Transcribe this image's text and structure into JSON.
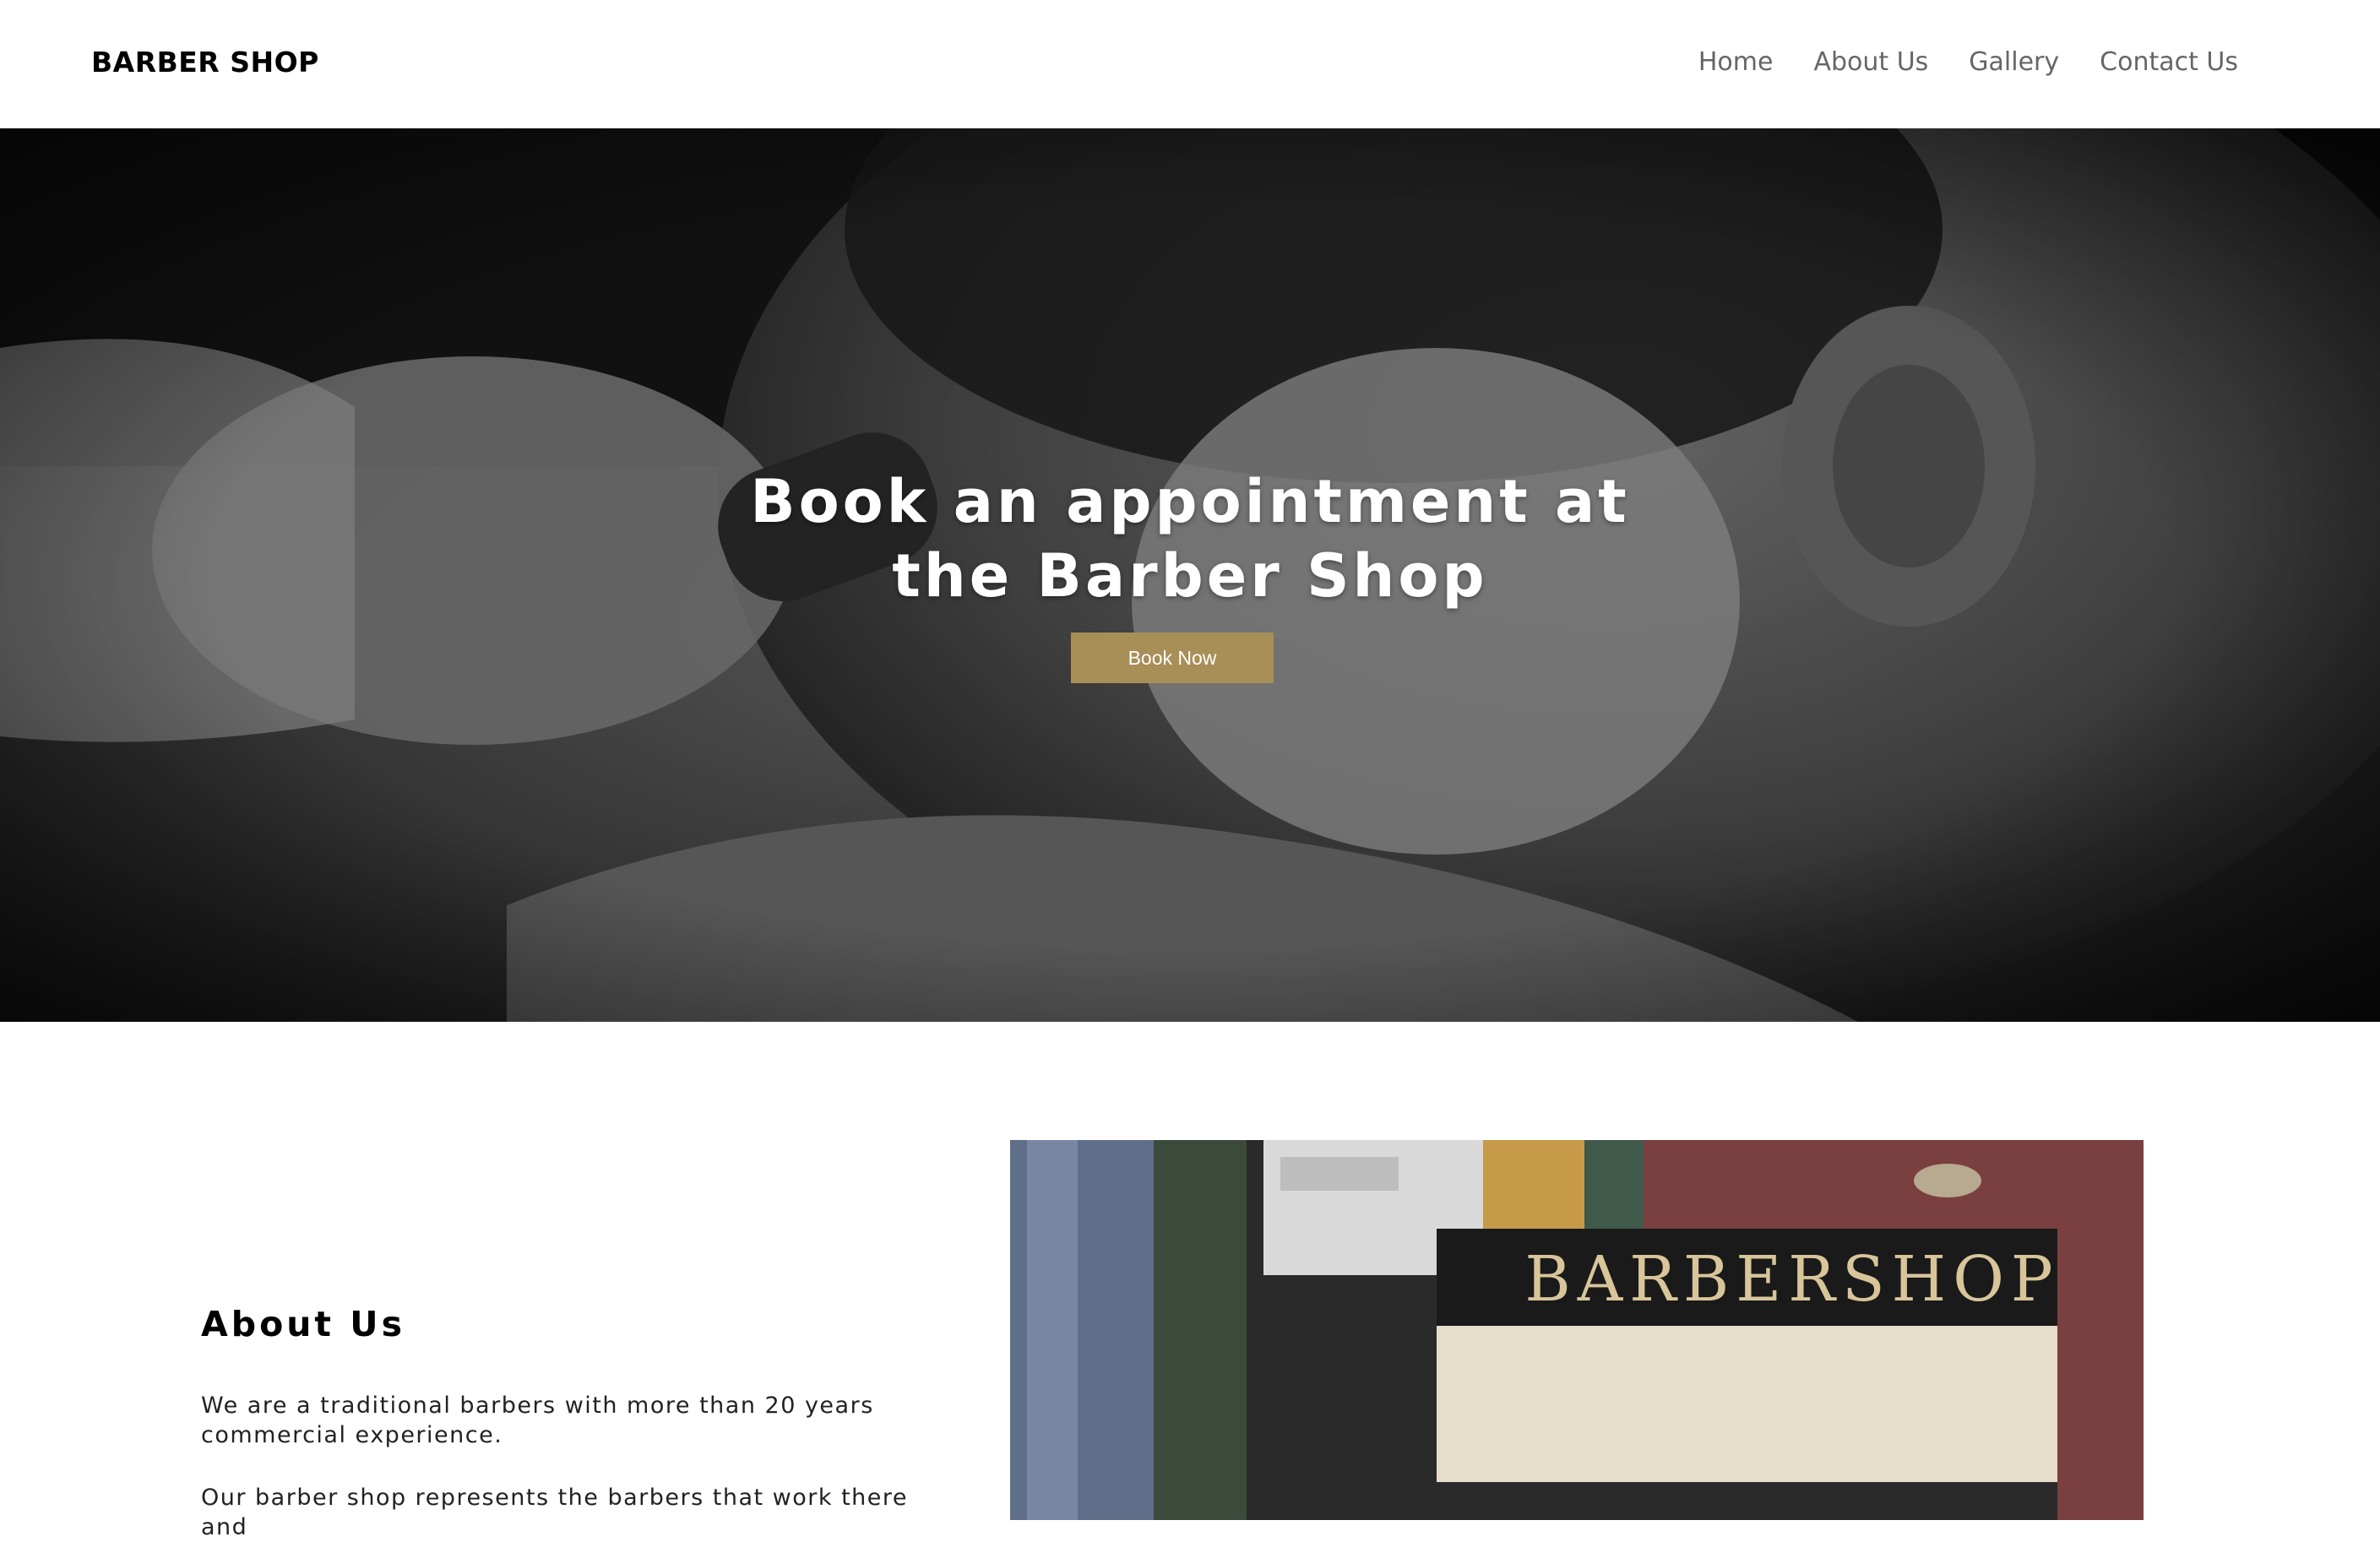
{
  "header": {
    "brand": "BARBER SHOP",
    "nav": [
      {
        "label": "Home"
      },
      {
        "label": "About Us"
      },
      {
        "label": "Gallery"
      },
      {
        "label": "Contact Us"
      }
    ]
  },
  "hero": {
    "title_line1": "Book an appointment at",
    "title_line2": "the Barber Shop",
    "button_label": "Book Now"
  },
  "about": {
    "title": "About Us",
    "paragraph1": "We are a traditional barbers with more than 20 years commercial experience.",
    "paragraph2": "Our barber shop represents the barbers that work there and",
    "image_sign_text": "BARBERSHOP"
  },
  "colors": {
    "accent": "#a88e57",
    "nav_text": "#666666",
    "brand_text": "#000000"
  }
}
